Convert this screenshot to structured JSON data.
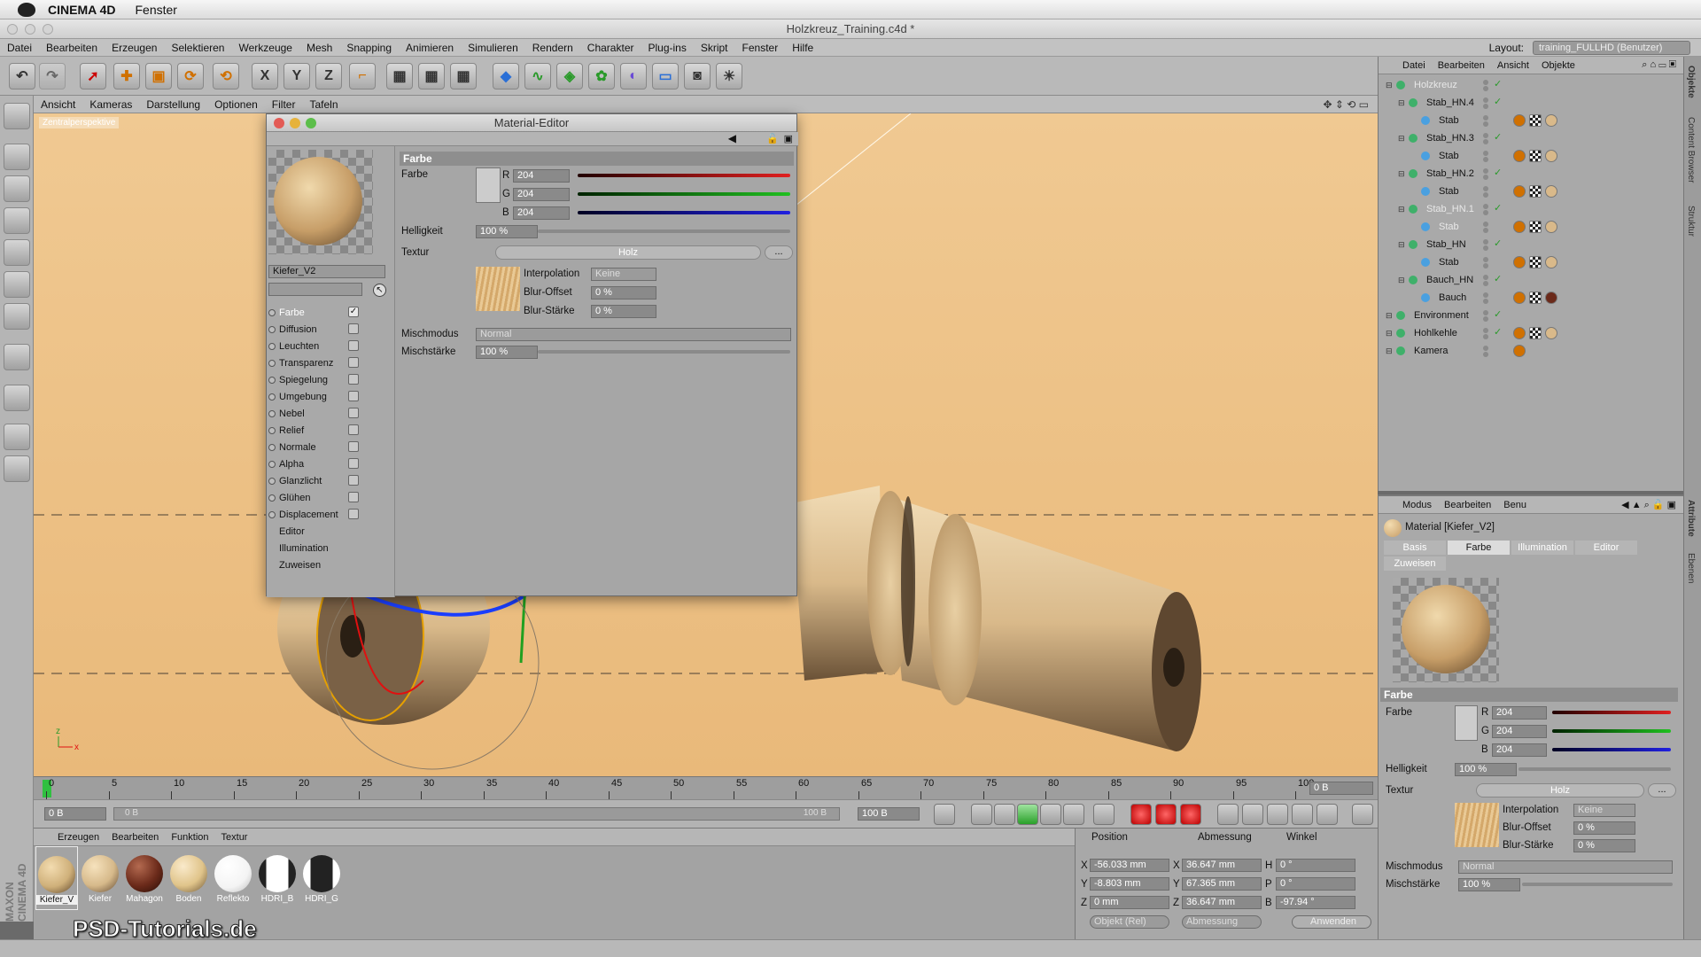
{
  "mac_menu": {
    "app": "CINEMA 4D",
    "items": [
      "Fenster"
    ]
  },
  "window_title": "Holzkreuz_Training.c4d *",
  "main_menu": [
    "Datei",
    "Bearbeiten",
    "Erzeugen",
    "Selektieren",
    "Werkzeuge",
    "Mesh",
    "Snapping",
    "Animieren",
    "Simulieren",
    "Rendern",
    "Charakter",
    "Plug-ins",
    "Skript",
    "Fenster",
    "Hilfe"
  ],
  "layout": {
    "label": "Layout:",
    "value": "training_FULLHD (Benutzer)"
  },
  "toolbar_axes": [
    "X",
    "Y",
    "Z"
  ],
  "viewport_menu": [
    "Ansicht",
    "Kameras",
    "Darstellung",
    "Optionen",
    "Filter",
    "Tafeln"
  ],
  "viewport_label": "Zentralperspektive",
  "material_editor": {
    "title": "Material-Editor",
    "material_name": "Kiefer_V2",
    "channels": [
      {
        "label": "Farbe",
        "checked": true
      },
      {
        "label": "Diffusion",
        "checked": false
      },
      {
        "label": "Leuchten",
        "checked": false
      },
      {
        "label": "Transparenz",
        "checked": false
      },
      {
        "label": "Spiegelung",
        "checked": false
      },
      {
        "label": "Umgebung",
        "checked": false
      },
      {
        "label": "Nebel",
        "checked": false
      },
      {
        "label": "Relief",
        "checked": false
      },
      {
        "label": "Normale",
        "checked": false
      },
      {
        "label": "Alpha",
        "checked": false
      },
      {
        "label": "Glanzlicht",
        "checked": false
      },
      {
        "label": "Glühen",
        "checked": false
      },
      {
        "label": "Displacement",
        "checked": false
      }
    ],
    "extra_items": [
      "Editor",
      "Illumination",
      "Zuweisen"
    ],
    "section": "Farbe",
    "farbe_label": "Farbe",
    "r_label": "R",
    "r": "204",
    "g_label": "G",
    "g": "204",
    "b_label": "B",
    "b": "204",
    "helligkeit_label": "Helligkeit",
    "helligkeit": "100 %",
    "textur_label": "Textur",
    "textur": "Holz",
    "textur_more": "...",
    "interpolation_label": "Interpolation",
    "interpolation": "Keine",
    "blur_offset_label": "Blur-Offset",
    "blur_offset": "0 %",
    "blur_staerke_label": "Blur-Stärke",
    "blur_staerke": "0 %",
    "mischmodus_label": "Mischmodus",
    "mischmodus": "Normal",
    "mischstaerke_label": "Mischstärke",
    "mischstaerke": "100 %"
  },
  "objects_panel": {
    "menu": [
      "Datei",
      "Bearbeiten",
      "Ansicht",
      "Objekte"
    ],
    "items": [
      {
        "name": "Holzkreuz",
        "level": 0,
        "dim": true
      },
      {
        "name": "Stab_HN.4",
        "level": 1
      },
      {
        "name": "Stab",
        "level": 2
      },
      {
        "name": "Stab_HN.3",
        "level": 1
      },
      {
        "name": "Stab",
        "level": 2
      },
      {
        "name": "Stab_HN.2",
        "level": 1
      },
      {
        "name": "Stab",
        "level": 2
      },
      {
        "name": "Stab_HN.1",
        "level": 1,
        "dim": true
      },
      {
        "name": "Stab",
        "level": 2,
        "dim": true
      },
      {
        "name": "Stab_HN",
        "level": 1
      },
      {
        "name": "Stab",
        "level": 2
      },
      {
        "name": "Bauch_HN",
        "level": 1
      },
      {
        "name": "Bauch",
        "level": 2
      },
      {
        "name": "Environment",
        "level": 0
      },
      {
        "name": "Hohlkehle",
        "level": 0
      },
      {
        "name": "Kamera",
        "level": 0
      }
    ]
  },
  "attributes_panel": {
    "menu": [
      "Modus",
      "Bearbeiten",
      "Benu"
    ],
    "title": "Material [Kiefer_V2]",
    "tabs": [
      "Basis",
      "Farbe",
      "Illumination",
      "Editor"
    ],
    "active_tab": "Farbe",
    "tab_zuweisen": "Zuweisen",
    "section": "Farbe",
    "farbe_label": "Farbe",
    "r_label": "R",
    "r": "204",
    "g_label": "G",
    "g": "204",
    "b_label": "B",
    "b": "204",
    "helligkeit_label": "Helligkeit",
    "helligkeit": "100 %",
    "textur_label": "Textur",
    "textur": "Holz",
    "textur_more": "...",
    "interpolation_label": "Interpolation",
    "interpolation": "Keine",
    "blur_offset_label": "Blur-Offset",
    "blur_offset": "0 %",
    "blur_staerke_label": "Blur-Stärke",
    "blur_staerke": "0 %",
    "mischmodus_label": "Mischmodus",
    "mischmodus": "Normal",
    "mischstaerke_label": "Mischstärke",
    "mischstaerke": "100 %"
  },
  "right_tabs": [
    "Objekte",
    "Content Browser",
    "Struktur",
    "Attribute",
    "Ebenen"
  ],
  "timeline": {
    "ticks": [
      "0",
      "5",
      "10",
      "15",
      "20",
      "25",
      "30",
      "35",
      "40",
      "45",
      "50",
      "55",
      "60",
      "65",
      "70",
      "75",
      "80",
      "85",
      "90",
      "95",
      "100"
    ],
    "end_frame": "0 B",
    "start_field": "0 B",
    "range_start": "0 B",
    "range_end": "100 B",
    "max_field": "100 B"
  },
  "materials_bar": {
    "menu": [
      "Erzeugen",
      "Bearbeiten",
      "Funktion",
      "Textur"
    ],
    "materials": [
      {
        "name": "Kiefer_V",
        "color": "#cfb07a"
      },
      {
        "name": "Kiefer",
        "color": "#d6b98a"
      },
      {
        "name": "Mahagon",
        "color": "#6b2a1a"
      },
      {
        "name": "Boden",
        "color": "#e0c48a"
      },
      {
        "name": "Reflekto",
        "color": "#f4f4f4"
      },
      {
        "name": "HDRI_B",
        "color": "#dcdcdc"
      },
      {
        "name": "HDRI_G",
        "color": "#6a6a6a"
      }
    ]
  },
  "coordinates": {
    "headers": [
      "Position",
      "Abmessung",
      "Winkel"
    ],
    "rows": [
      {
        "axis": "X",
        "pos": "-56.033 mm",
        "size_axis": "X",
        "size": "36.647 mm",
        "rot_axis": "H",
        "rot": "0 °"
      },
      {
        "axis": "Y",
        "pos": "-8.803 mm",
        "size_axis": "Y",
        "size": "67.365 mm",
        "rot_axis": "P",
        "rot": "0 °"
      },
      {
        "axis": "Z",
        "pos": "0 mm",
        "size_axis": "Z",
        "size": "36.647 mm",
        "rot_axis": "B",
        "rot": "-97.94 °"
      }
    ],
    "mode": "Objekt (Rel)",
    "size_mode": "Abmessung",
    "apply": "Anwenden"
  },
  "branding": {
    "maxon": "MAXON CINEMA 4D",
    "watermark": "PSD-Tutorials.de"
  },
  "colors": {
    "accent_red": "#e02020",
    "accent_green": "#20c020",
    "accent_blue": "#2020e0",
    "wood": "#d9b98a"
  }
}
